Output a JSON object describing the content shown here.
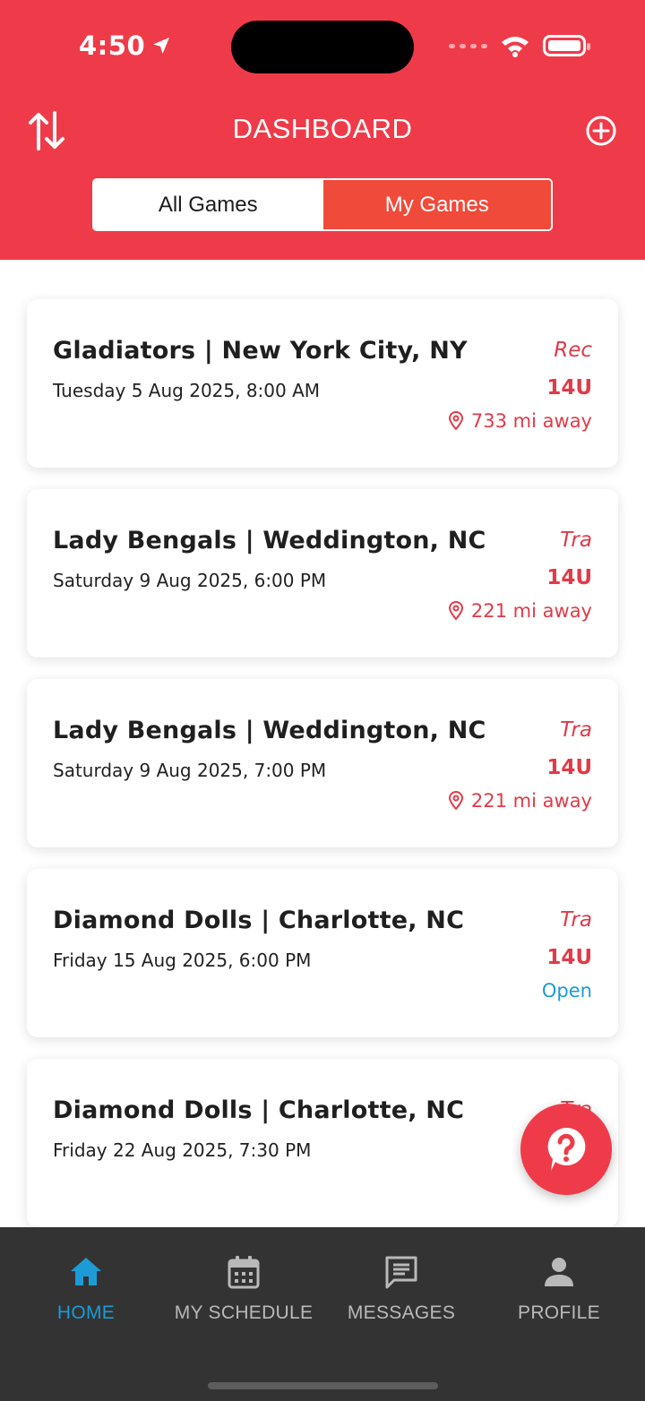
{
  "status_bar": {
    "time": "4:50"
  },
  "header": {
    "title": "DASHBOARD",
    "sort_icon": "sort-arrows-icon",
    "add_icon": "plus-circle-icon",
    "tabs": [
      {
        "label": "All Games",
        "selected": false
      },
      {
        "label": "My Games",
        "selected": true
      }
    ]
  },
  "games": [
    {
      "title": "Gladiators | New York City, NY",
      "datetime": "Tuesday 5 Aug 2025, 8:00 AM",
      "type": "Rec",
      "age": "14U",
      "distance": "733 mi away"
    },
    {
      "title": "Lady Bengals | Weddington, NC",
      "datetime": "Saturday 9 Aug 2025, 6:00 PM",
      "type": "Tra",
      "age": "14U",
      "distance": "221 mi away"
    },
    {
      "title": "Lady Bengals | Weddington, NC",
      "datetime": "Saturday 9 Aug 2025, 7:00 PM",
      "type": "Tra",
      "age": "14U",
      "distance": "221 mi away"
    },
    {
      "title": "Diamond Dolls | Charlotte, NC",
      "datetime": "Friday 15 Aug 2025, 6:00 PM",
      "type": "Tra",
      "age": "14U",
      "status": "Open"
    },
    {
      "title": "Diamond Dolls | Charlotte, NC",
      "datetime": "Friday 22 Aug 2025, 7:30 PM",
      "type": "Tra"
    }
  ],
  "nav": {
    "items": [
      {
        "label": "HOME",
        "icon": "home-icon",
        "active": true
      },
      {
        "label": "MY SCHEDULE",
        "icon": "calendar-icon",
        "active": false
      },
      {
        "label": "MESSAGES",
        "icon": "message-icon",
        "active": false
      },
      {
        "label": "PROFILE",
        "icon": "person-icon",
        "active": false
      }
    ]
  },
  "colors": {
    "brand": "#ef3b49",
    "accent_blue": "#1c9bd6",
    "nav_bg": "#333333"
  }
}
